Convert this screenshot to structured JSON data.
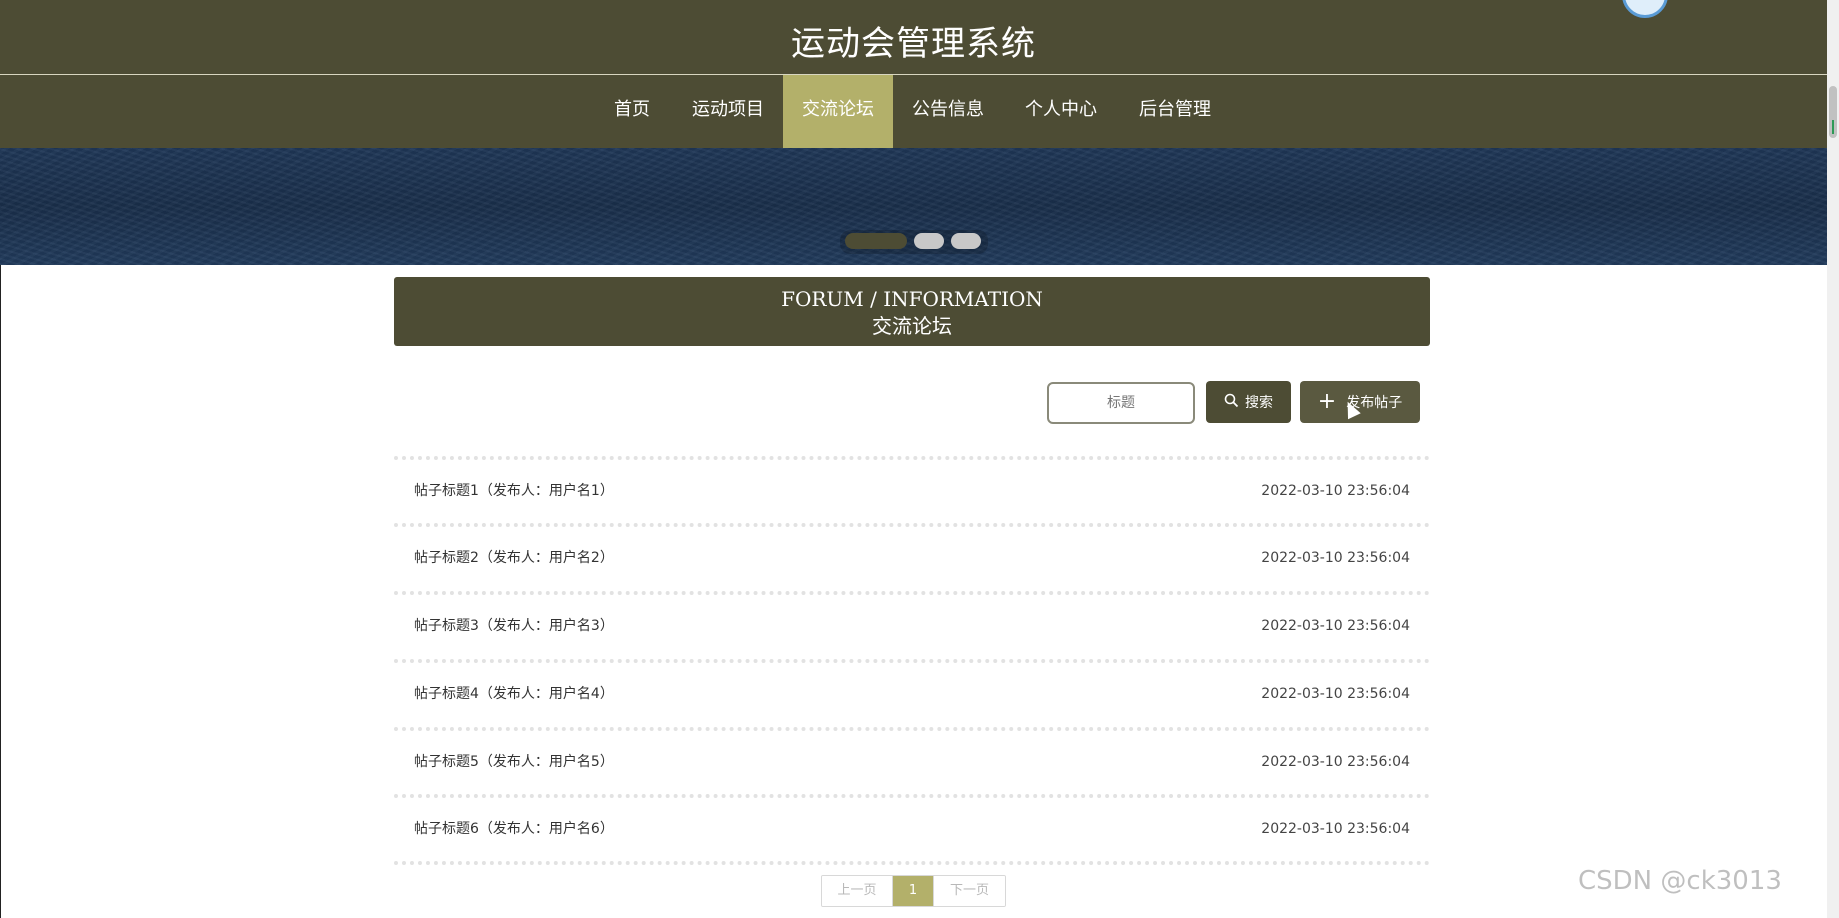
{
  "header": {
    "title": "运动会管理系统"
  },
  "nav": {
    "items": [
      {
        "label": "首页"
      },
      {
        "label": "运动项目"
      },
      {
        "label": "交流论坛",
        "active": true
      },
      {
        "label": "公告信息"
      },
      {
        "label": "个人中心"
      },
      {
        "label": "后台管理"
      }
    ]
  },
  "banner": {
    "slide_count": 3,
    "active_slide": 1
  },
  "section": {
    "title_en": "FORUM / INFORMATION",
    "title_cn": "交流论坛"
  },
  "toolbar": {
    "search_placeholder": "标题",
    "search_label": "搜索",
    "post_label": "发布帖子"
  },
  "posts": [
    {
      "title": "帖子标题1（发布人：用户名1）",
      "time": "2022-03-10 23:56:04"
    },
    {
      "title": "帖子标题2（发布人：用户名2）",
      "time": "2022-03-10 23:56:04"
    },
    {
      "title": "帖子标题3（发布人：用户名3）",
      "time": "2022-03-10 23:56:04"
    },
    {
      "title": "帖子标题4（发布人：用户名4）",
      "time": "2022-03-10 23:56:04"
    },
    {
      "title": "帖子标题5（发布人：用户名5）",
      "time": "2022-03-10 23:56:04"
    },
    {
      "title": "帖子标题6（发布人：用户名6）",
      "time": "2022-03-10 23:56:04"
    }
  ],
  "pagination": {
    "prev_label": "上一页",
    "current": "1",
    "next_label": "下一页"
  },
  "watermark": "CSDN @ck3013",
  "colors": {
    "primary": "#4d4c34",
    "accent": "#b3b06a",
    "banner": "#1f3757"
  },
  "icons": {
    "search": "search-icon",
    "add": "plus-icon"
  }
}
